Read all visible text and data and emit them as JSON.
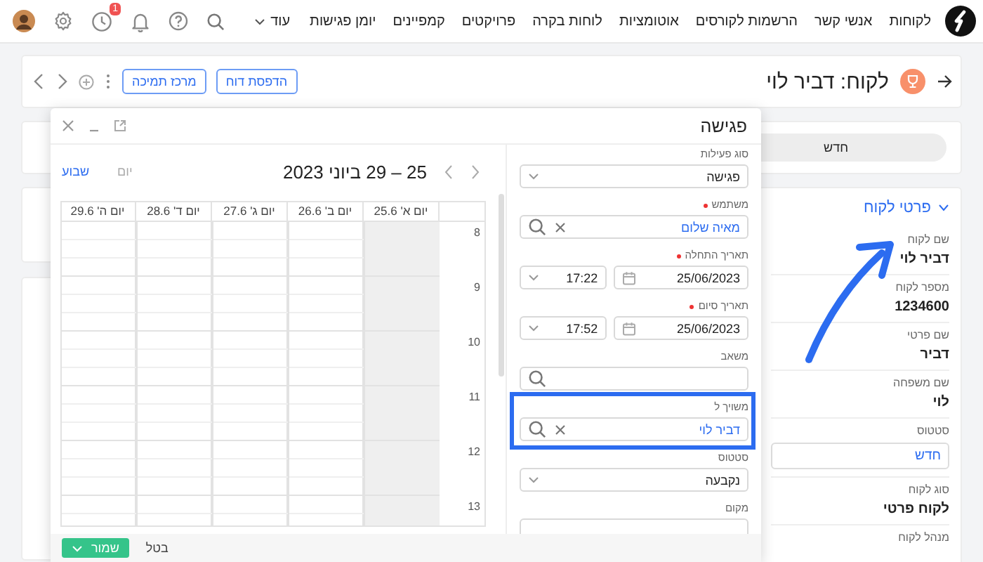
{
  "nav": {
    "items": [
      "לקוחות",
      "אנשי קשר",
      "הרשמות לקורסים",
      "אוטומציות",
      "לוחות בקרה",
      "פרויקטים",
      "קמפיינים",
      "יומן פגישות"
    ],
    "more": "עוד",
    "badge": "1"
  },
  "header": {
    "title": "לקוח: דביר לוי",
    "buttons": [
      "הדפסת דוח",
      "מרכז תמיכה"
    ]
  },
  "status_bar": {
    "stages": [
      {
        "label": "חדש",
        "selected": true
      }
    ]
  },
  "details": {
    "title": "פרטי לקוח",
    "expanded": true,
    "fields": [
      {
        "kind": "text",
        "label": "שם לקוח",
        "value": "דביר לוי"
      },
      {
        "kind": "text",
        "label": "מספר לקוח",
        "value": "1234600"
      },
      {
        "kind": "text",
        "label": "שם פרטי",
        "value": "דביר"
      },
      {
        "kind": "text",
        "label": "שם משפחה",
        "value": "לוי"
      },
      {
        "kind": "box",
        "label": "סטטוס",
        "value": "חדש"
      },
      {
        "kind": "text",
        "label": "סוג לקוח",
        "value": "לקוח פרטי"
      },
      {
        "kind": "text",
        "label": "מנהל לקוח"
      }
    ]
  },
  "dialog": {
    "title": "פגישה",
    "form": [
      {
        "kind": "select",
        "label": "סוג פעילות",
        "required": false,
        "value": "פגישה",
        "highlighted": false
      },
      {
        "kind": "lookup",
        "label": "משתמש",
        "required": true,
        "value": "מאיה שלום",
        "highlighted": false
      },
      {
        "kind": "datetime",
        "label": "תאריך התחלה",
        "required": true,
        "date": "25/06/2023",
        "time": "17:22",
        "highlighted": false
      },
      {
        "kind": "datetime",
        "label": "תאריך סיום",
        "required": true,
        "date": "25/06/2023",
        "time": "17:52",
        "highlighted": false
      },
      {
        "kind": "lookup",
        "label": "משאב",
        "required": false,
        "highlighted": false
      },
      {
        "kind": "lookup",
        "label": "משויך ל",
        "required": false,
        "value": "דביר לוי",
        "highlighted": true
      },
      {
        "kind": "select",
        "label": "סטטוס",
        "required": false,
        "value": "נקבעה",
        "highlighted": false
      },
      {
        "kind": "text",
        "label": "מקום",
        "required": false,
        "highlighted": false
      }
    ],
    "calendar": {
      "title": "25 – 29 ביוני 2023",
      "views": [
        {
          "label": "יום",
          "selected": false
        },
        {
          "label": "שבוע",
          "selected": true
        }
      ],
      "days": [
        {
          "label": "יום א' 25.6",
          "today": true
        },
        {
          "label": "יום ב' 26.6",
          "today": false
        },
        {
          "label": "יום ג' 27.6",
          "today": false
        },
        {
          "label": "יום ד' 28.6",
          "today": false
        },
        {
          "label": "יום ה' 29.6",
          "today": false
        }
      ],
      "hours": [
        "8",
        "9",
        "10",
        "11",
        "12",
        "13"
      ]
    },
    "footer": {
      "save": "שמור",
      "cancel": "בטל"
    }
  }
}
